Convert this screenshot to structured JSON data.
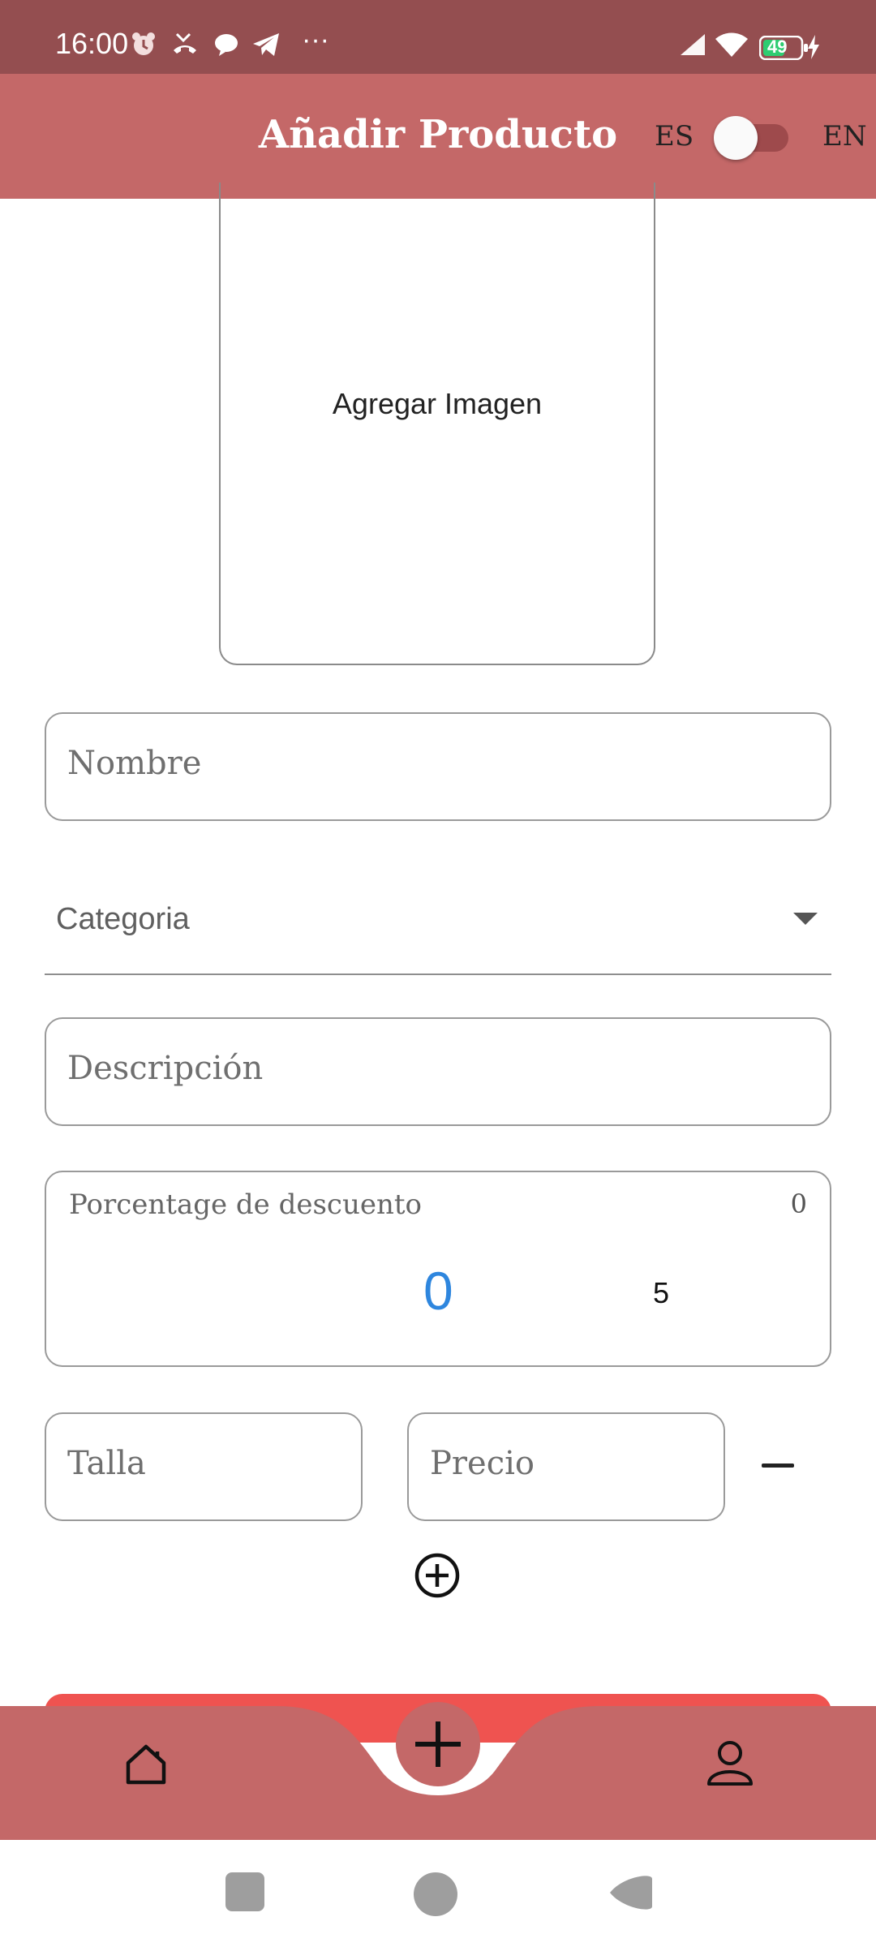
{
  "status_bar": {
    "time": "16:00",
    "more": "···",
    "battery": "49"
  },
  "app_bar": {
    "title": "Añadir Producto",
    "lang_left": "ES",
    "lang_right": "EN"
  },
  "form": {
    "image_picker_label": "Agregar Imagen",
    "name_placeholder": "Nombre",
    "category_label": "Categoria",
    "description_placeholder": "Descripción",
    "discount": {
      "label": "Porcentage de descuento",
      "current_value": "0",
      "picker_selected": "0",
      "picker_next": "5"
    },
    "size_placeholder": "Talla",
    "price_placeholder": "Precio"
  },
  "colors": {
    "status_bar": "#944e50",
    "app_bar": "#c46868",
    "accent_blue": "#2e86de",
    "save_button": "#ef5350"
  },
  "icons": {
    "home": "home-icon",
    "add": "plus-icon",
    "profile": "user-icon",
    "add_size": "plus-circle-icon",
    "remove_size": "minus-icon",
    "dropdown": "caret-down-icon"
  }
}
